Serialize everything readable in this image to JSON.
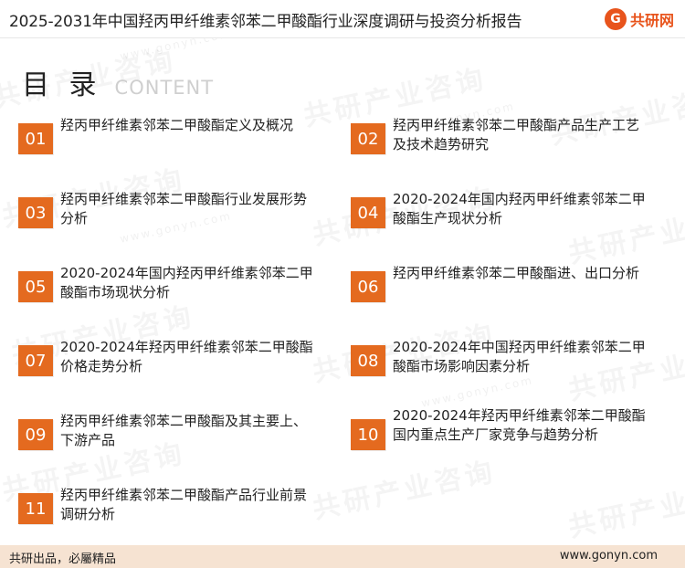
{
  "header": {
    "title": "2025-2031年中国羟丙甲纤维素邻苯二甲酸酯行业深度调研与投资分析报告",
    "logo_mark": "G",
    "logo_text": "共研网"
  },
  "watermark": {
    "text": "共研产业咨询",
    "url": "www.gonyn.com"
  },
  "toc": {
    "title": "目 录",
    "subtitle": "CONTENT",
    "items": [
      {
        "num": "01",
        "label": "羟丙甲纤维素邻苯二甲酸酯定义及概况"
      },
      {
        "num": "02",
        "label": "羟丙甲纤维素邻苯二甲酸酯产品生产工艺及技术趋势研究"
      },
      {
        "num": "03",
        "label": "羟丙甲纤维素邻苯二甲酸酯行业发展形势分析"
      },
      {
        "num": "04",
        "label": "2020-2024年国内羟丙甲纤维素邻苯二甲酸酯生产现状分析"
      },
      {
        "num": "05",
        "label": "2020-2024年国内羟丙甲纤维素邻苯二甲酸酯市场现状分析"
      },
      {
        "num": "06",
        "label": "羟丙甲纤维素邻苯二甲酸酯进、出口分析"
      },
      {
        "num": "07",
        "label": "2020-2024年羟丙甲纤维素邻苯二甲酸酯价格走势分析"
      },
      {
        "num": "08",
        "label": "2020-2024年中国羟丙甲纤维素邻苯二甲酸酯市场影响因素分析"
      },
      {
        "num": "09",
        "label": "羟丙甲纤维素邻苯二甲酸酯及其主要上、下游产品"
      },
      {
        "num": "10",
        "label": "2020-2024年羟丙甲纤维素邻苯二甲酸酯国内重点生产厂家竞争与趋势分析"
      },
      {
        "num": "11",
        "label": "羟丙甲纤维素邻苯二甲酸酯产品行业前景调研分析"
      }
    ]
  },
  "footer": {
    "left": "共研出品，必屬精品",
    "right": "www.gonyn.com"
  },
  "colors": {
    "accent": "#e46a1f",
    "footer_bg": "#f6e3d2"
  }
}
